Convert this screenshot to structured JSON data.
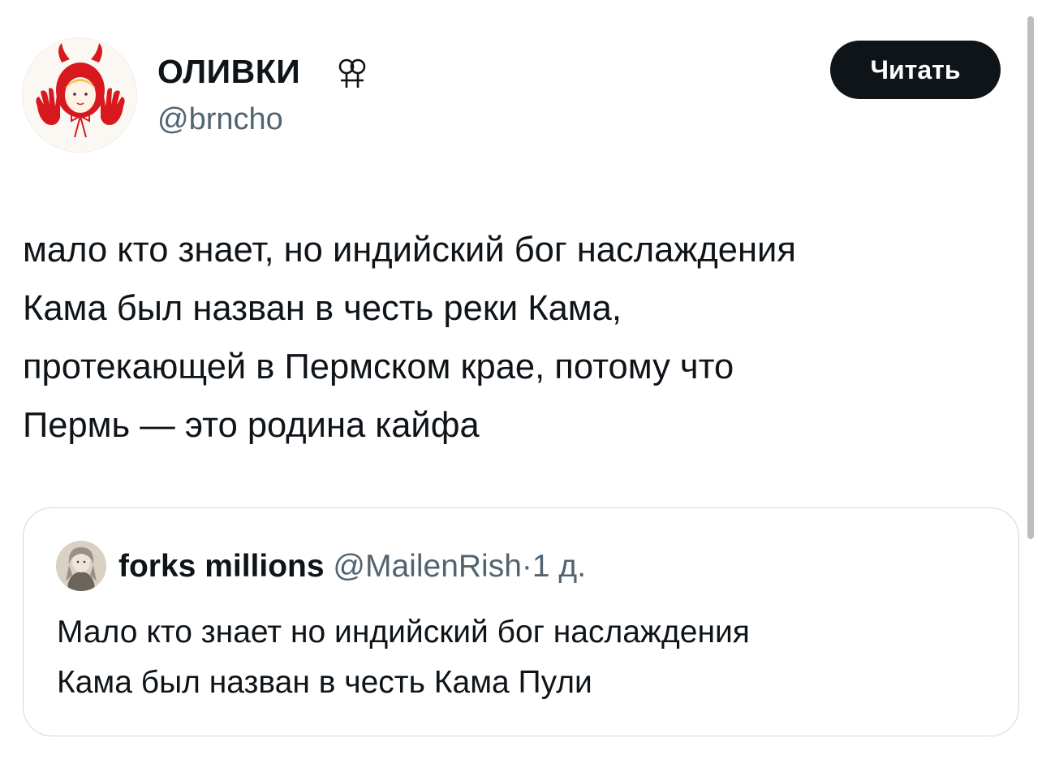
{
  "author": {
    "display_name": "ОЛИВКИ",
    "name_icon": "double-venus-icon",
    "handle": "@brncho",
    "avatar_icon": "red-devil-hood-avatar"
  },
  "follow_button": {
    "label": "Читать"
  },
  "tweet": {
    "text": "мало кто знает, но индийский бог наслаждения\nКама был назван в честь реки Кама,\nпротекающей в Пермском крае, потому что\nПермь — это родина кайфа"
  },
  "quoted_tweet": {
    "display_name": "forks millions",
    "handle": "@MailenRish",
    "separator": "·",
    "time": "1 д.",
    "text": "Мало кто знает но индийский бог наслаждения\nКама был назван в честь Кама Пули",
    "avatar_icon": "sketch-portrait-avatar"
  },
  "colors": {
    "text_primary": "#0f1419",
    "text_secondary": "#536471",
    "button_bg": "#0f1419",
    "border": "#cfd9de",
    "avatar_red": "#d7191f"
  }
}
